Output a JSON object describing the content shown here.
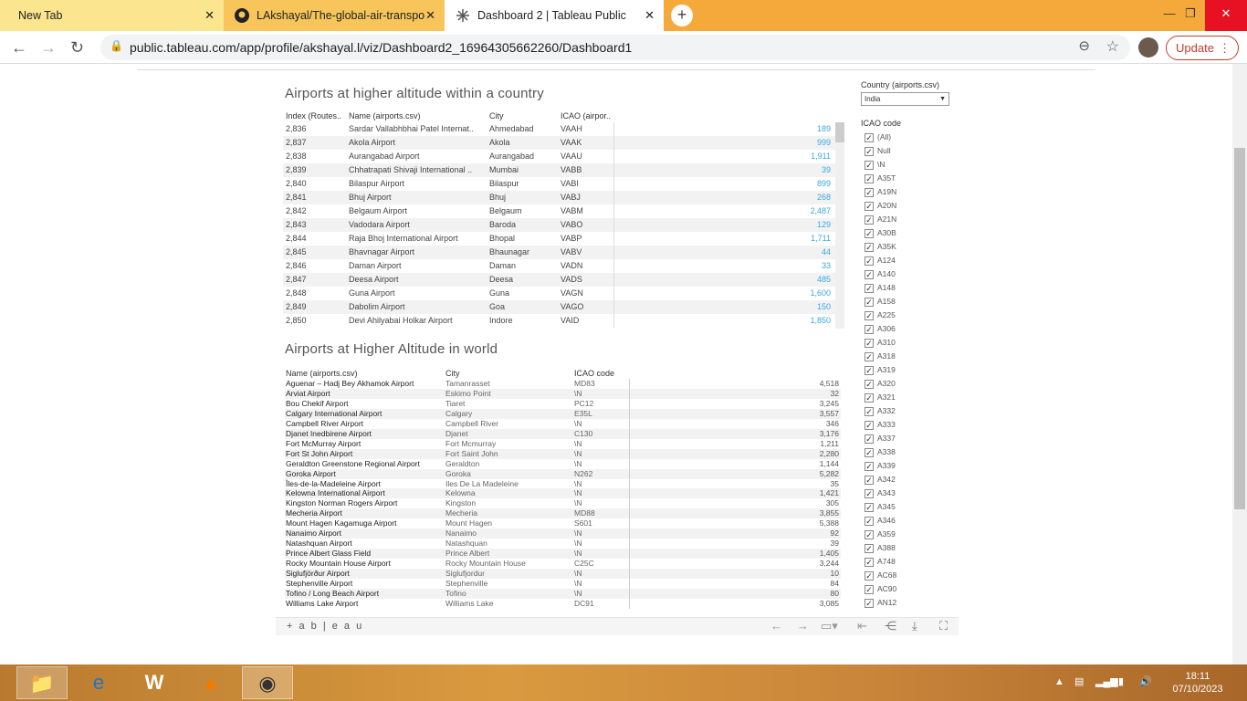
{
  "browser": {
    "tabs": [
      {
        "title": "New Tab"
      },
      {
        "title": "LAkshayal/The-global-air-transpo"
      },
      {
        "title": "Dashboard 2 | Tableau Public"
      }
    ],
    "url": "public.tableau.com/app/profile/akshayal.l/viz/Dashboard2_16964305662260/Dashboard1",
    "update_label": "Update"
  },
  "dashboard": {
    "title1": "Airports at higher altitude within a country",
    "table1_headers": [
      "Index (Routes..",
      "Name (airports.csv)",
      "City",
      "ICAO (airpor.."
    ],
    "table1_rows": [
      {
        "idx": "2,836",
        "name": "Sardar Vallabhbhai Patel Internat..",
        "city": "Ahmedabad",
        "icao": "VAAH",
        "val": "189"
      },
      {
        "idx": "2,837",
        "name": "Akola Airport",
        "city": "Akola",
        "icao": "VAAK",
        "val": "999"
      },
      {
        "idx": "2,838",
        "name": "Aurangabad Airport",
        "city": "Aurangabad",
        "icao": "VAAU",
        "val": "1,911"
      },
      {
        "idx": "2,839",
        "name": "Chhatrapati Shivaji International ..",
        "city": "Mumbai",
        "icao": "VABB",
        "val": "39"
      },
      {
        "idx": "2,840",
        "name": "Bilaspur Airport",
        "city": "Bilaspur",
        "icao": "VABI",
        "val": "899"
      },
      {
        "idx": "2,841",
        "name": "Bhuj Airport",
        "city": "Bhuj",
        "icao": "VABJ",
        "val": "268"
      },
      {
        "idx": "2,842",
        "name": "Belgaum Airport",
        "city": "Belgaum",
        "icao": "VABM",
        "val": "2,487"
      },
      {
        "idx": "2,843",
        "name": "Vadodara Airport",
        "city": "Baroda",
        "icao": "VABO",
        "val": "129"
      },
      {
        "idx": "2,844",
        "name": "Raja Bhoj International Airport",
        "city": "Bhopal",
        "icao": "VABP",
        "val": "1,711"
      },
      {
        "idx": "2,845",
        "name": "Bhavnagar Airport",
        "city": "Bhaunagar",
        "icao": "VABV",
        "val": "44"
      },
      {
        "idx": "2,846",
        "name": "Daman Airport",
        "city": "Daman",
        "icao": "VADN",
        "val": "33"
      },
      {
        "idx": "2,847",
        "name": "Deesa Airport",
        "city": "Deesa",
        "icao": "VADS",
        "val": "485"
      },
      {
        "idx": "2,848",
        "name": "Guna Airport",
        "city": "Guna",
        "icao": "VAGN",
        "val": "1,600"
      },
      {
        "idx": "2,849",
        "name": "Dabolim Airport",
        "city": "Goa",
        "icao": "VAGO",
        "val": "150"
      },
      {
        "idx": "2,850",
        "name": "Devi Ahilyabai Holkar Airport",
        "city": "Indore",
        "icao": "VAID",
        "val": "1,850"
      }
    ],
    "title2": "Airports at Higher Altitude in world",
    "table2_headers": [
      "Name (airports.csv)",
      "City",
      "ICAO code"
    ],
    "table2_rows": [
      {
        "name": "Aguenar – Hadj Bey Akhamok Airport",
        "city": "Tamanrasset",
        "icao": "MD83",
        "val": "4,518"
      },
      {
        "name": "Arviat Airport",
        "city": "Eskimo Point",
        "icao": "\\N",
        "val": "32"
      },
      {
        "name": "Bou Chekif Airport",
        "city": "Tiaret",
        "icao": "PC12",
        "val": "3,245"
      },
      {
        "name": "Calgary International Airport",
        "city": "Calgary",
        "icao": "E35L",
        "val": "3,557"
      },
      {
        "name": "Campbell River Airport",
        "city": "Campbell River",
        "icao": "\\N",
        "val": "346"
      },
      {
        "name": "Djanet Inedbirene Airport",
        "city": "Djanet",
        "icao": "C130",
        "val": "3,176"
      },
      {
        "name": "Fort McMurray Airport",
        "city": "Fort Mcmurray",
        "icao": "\\N",
        "val": "1,211"
      },
      {
        "name": "Fort St John Airport",
        "city": "Fort Saint John",
        "icao": "\\N",
        "val": "2,280"
      },
      {
        "name": "Geraldton Greenstone Regional Airport",
        "city": "Geraldton",
        "icao": "\\N",
        "val": "1,144"
      },
      {
        "name": "Goroka Airport",
        "city": "Goroka",
        "icao": "N262",
        "val": "5,282"
      },
      {
        "name": "Îles-de-la-Madeleine Airport",
        "city": "Iles De La Madeleine",
        "icao": "\\N",
        "val": "35"
      },
      {
        "name": "Kelowna International Airport",
        "city": "Kelowna",
        "icao": "\\N",
        "val": "1,421"
      },
      {
        "name": "Kingston Norman Rogers Airport",
        "city": "Kingston",
        "icao": "\\N",
        "val": "305"
      },
      {
        "name": "Mecheria Airport",
        "city": "Mecheria",
        "icao": "MD88",
        "val": "3,855"
      },
      {
        "name": "Mount Hagen Kagamuga Airport",
        "city": "Mount Hagen",
        "icao": "S601",
        "val": "5,388"
      },
      {
        "name": "Nanaimo Airport",
        "city": "Nanaimo",
        "icao": "\\N",
        "val": "92"
      },
      {
        "name": "Natashquan Airport",
        "city": "Natashquan",
        "icao": "\\N",
        "val": "39"
      },
      {
        "name": "Prince Albert Glass Field",
        "city": "Prince Albert",
        "icao": "\\N",
        "val": "1,405"
      },
      {
        "name": "Rocky Mountain House Airport",
        "city": "Rocky Mountain House",
        "icao": "C25C",
        "val": "3,244"
      },
      {
        "name": "Siglufjörður Airport",
        "city": "Siglufjordur",
        "icao": "\\N",
        "val": "10"
      },
      {
        "name": "Stephenville Airport",
        "city": "Stephenville",
        "icao": "\\N",
        "val": "84"
      },
      {
        "name": "Tofino / Long Beach Airport",
        "city": "Tofino",
        "icao": "\\N",
        "val": "80"
      },
      {
        "name": "Williams Lake Airport",
        "city": "Williams Lake",
        "icao": "DC91",
        "val": "3,085"
      }
    ],
    "filter_country_label": "Country (airports.csv)",
    "filter_country_value": "India",
    "filter_icao_label": "ICAO code",
    "icao_options": [
      "(All)",
      "Null",
      "\\N",
      "A35T",
      "A19N",
      "A20N",
      "A21N",
      "A30B",
      "A35K",
      "A124",
      "A140",
      "A148",
      "A158",
      "A225",
      "A306",
      "A310",
      "A318",
      "A319",
      "A320",
      "A321",
      "A332",
      "A333",
      "A337",
      "A338",
      "A339",
      "A342",
      "A343",
      "A345",
      "A346",
      "A359",
      "A388",
      "A748",
      "AC68",
      "AC90",
      "AN12"
    ],
    "footer_logo": "+ a b | e a u"
  },
  "taskbar": {
    "time": "18:11",
    "date": "07/10/2023"
  }
}
